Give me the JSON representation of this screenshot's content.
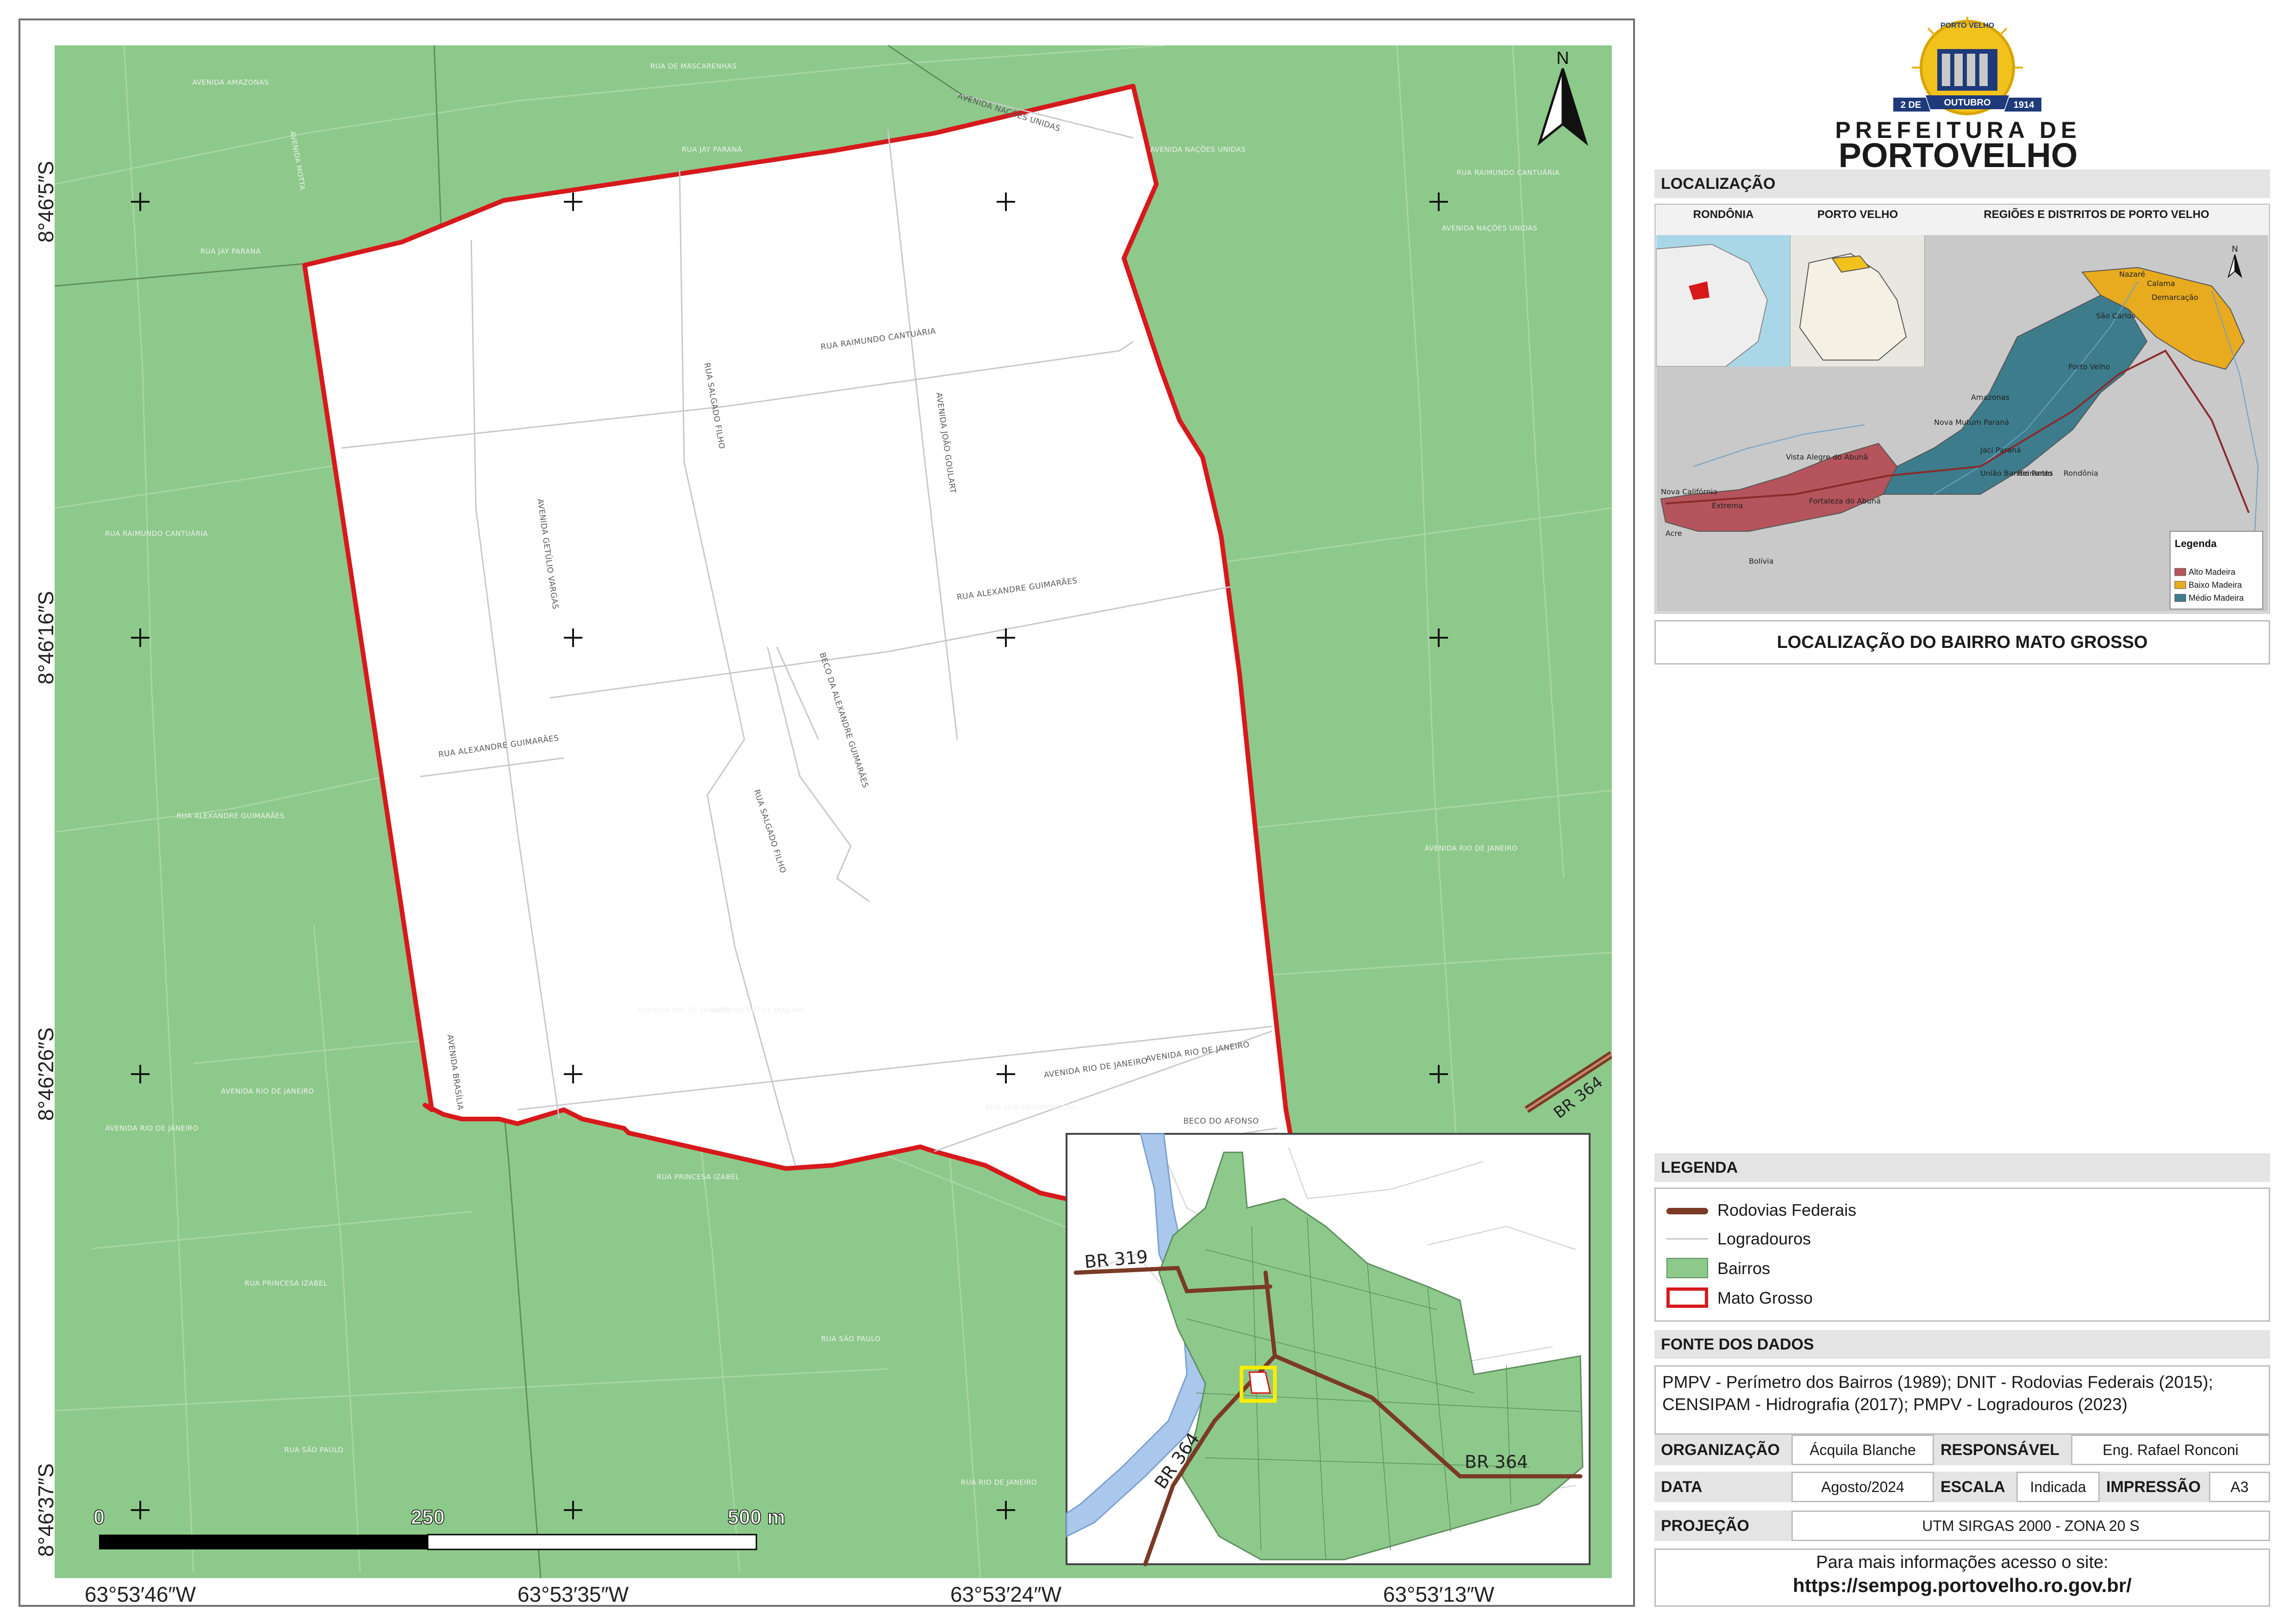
{
  "map": {
    "x_coordinates": [
      "63°53′46″W",
      "63°53′35″W",
      "63°53′24″W",
      "63°53′13″W"
    ],
    "y_coordinates": [
      "8°46′5″S",
      "8°46′16″S",
      "8°46′26″S",
      "8°46′37″S"
    ],
    "north_label": "N",
    "scale_labels": [
      "0",
      "250",
      "500 m"
    ],
    "road_labels": [
      "BR 364"
    ],
    "street_labels_outside": [
      "AVENIDA AMAZONAS",
      "RUA DE MASCARENHAS",
      "AVENIDA MOTTA",
      "RUA JAY PARANÁ",
      "RUA JAY PARANÁ",
      "RUA RAIMUNDO CANTUÁRIA",
      "AVENIDA NAÇÕES UNIDAS",
      "AVENIDA NAÇÕES UNIDAS",
      "RUA RAIMUNDO CANTUÁRIA",
      "RUA ALEXANDRE GUIMARÃES",
      "AVENIDA RIO DE JANEIRO",
      "AVENIDA RIO DE JANEIRO",
      "AVENIDA RIO DE JANEIRO",
      "AVENIDA RIO DE JANEIRO",
      "AVENIDA RIO DE JANEIRO",
      "RUA PRINCESA IZABEL",
      "RUA PRINCESA IZABEL",
      "RUA SÃO PAULO",
      "RUA SÃO PAULO",
      "RUA SEM DENOMINAÇÃO",
      "RUA RIO DE JANEIRO"
    ],
    "street_labels_inside": [
      "RUA RAIMUNDO CANTUÁRIA",
      "RUA SALGADO FILHO",
      "AVENIDA JOÃO GOULART",
      "AVENIDA GETÚLIO VARGAS",
      "RUA ALEXANDRE GUIMARÃES",
      "BECO DA ALEXANDRE GUIMARÃES",
      "RUA ALEXANDRE GUIMARÃES",
      "RUA SALGADO FILHO",
      "AVENIDA BRASÍLIA",
      "AVENIDA RIO DE JANEIRO",
      "AVENIDA RIO DE JANEIRO",
      "BECO DO AFONSO",
      "AVENIDA NAÇÕES UNIDAS"
    ]
  },
  "inset": {
    "road_labels": [
      "BR 319",
      "BR 364",
      "BR 364"
    ]
  },
  "header": {
    "logo_top": "PORTO VELHO",
    "logo_ribbon": "OUTUBRO",
    "logo_left_badge": "2 DE",
    "logo_right_badge": "1914",
    "prefeitura_line": "PREFEITURA DE",
    "city_line": "PORTOVELHO"
  },
  "localizacao": {
    "heading": "LOCALIZAÇÃO",
    "col_titles": [
      "RONDÔNIA",
      "PORTO VELHO",
      "REGIÕES E DISTRITOS DE PORTO VELHO"
    ],
    "place_labels": [
      "Amazonas",
      "Nazaré",
      "Calama",
      "Demarcação",
      "São Carlos",
      "Porto Velho",
      "Nova Mutum Paraná",
      "Jaci Paraná",
      "União Bandeirantes",
      "Rio Pardo",
      "Vista Alegre do Abunã",
      "Fortaleza do Abunã",
      "Extrema",
      "Nova Califórnia",
      "Acre",
      "Bolívia",
      "Rondônia"
    ],
    "legend_title": "Legenda",
    "legend_items": [
      {
        "label": "Alto Madeira",
        "color": "#b5545c"
      },
      {
        "label": "Baixo Madeira",
        "color": "#e8aa1e"
      },
      {
        "label": "Médio Madeira",
        "color": "#3d7c8c"
      }
    ],
    "subtitle": "LOCALIZAÇÃO DO BAIRRO MATO GROSSO"
  },
  "legenda": {
    "heading": "LEGENDA",
    "items": [
      {
        "label": "Rodovias Federais",
        "symbol": "road-line",
        "color": "#7a3a25"
      },
      {
        "label": "Logradouros",
        "symbol": "thin-line",
        "color": "#b0b0b0"
      },
      {
        "label": "Bairros",
        "symbol": "green-fill",
        "color": "#8dc98b"
      },
      {
        "label": "Mato Grosso",
        "symbol": "red-outline",
        "color": "#d7191c"
      }
    ]
  },
  "fonte": {
    "heading": "FONTE DOS DADOS",
    "text": "PMPV - Perímetro dos Bairros (1989); DNIT - Rodovias Federais (2015); CENSIPAM - Hidrografia (2017); PMPV - Logradouros (2023)"
  },
  "meta": {
    "organizacao_label": "ORGANIZAÇÃO",
    "organizacao_value": "Ácquila Blanche",
    "responsavel_label": "RESPONSÁVEL",
    "responsavel_value": "Eng. Rafael Ronconi",
    "data_label": "DATA",
    "data_value": "Agosto/2024",
    "escala_label": "ESCALA",
    "escala_value": "Indicada",
    "impressao_label": "IMPRESSÃO",
    "impressao_value": "A3",
    "projecao_label": "PROJEÇÃO",
    "projecao_value": "UTM SIRGAS 2000 - ZONA 20 S"
  },
  "footer": {
    "info_text": "Para mais informações acesso o site:",
    "url": "https://sempog.portovelho.ro.gov.br/"
  },
  "colors": {
    "bairros_green": "#8dc98b",
    "mato_grosso_red": "#d7191c",
    "road_brown": "#7a3a25",
    "panel_grey": "#e4e4e4"
  }
}
